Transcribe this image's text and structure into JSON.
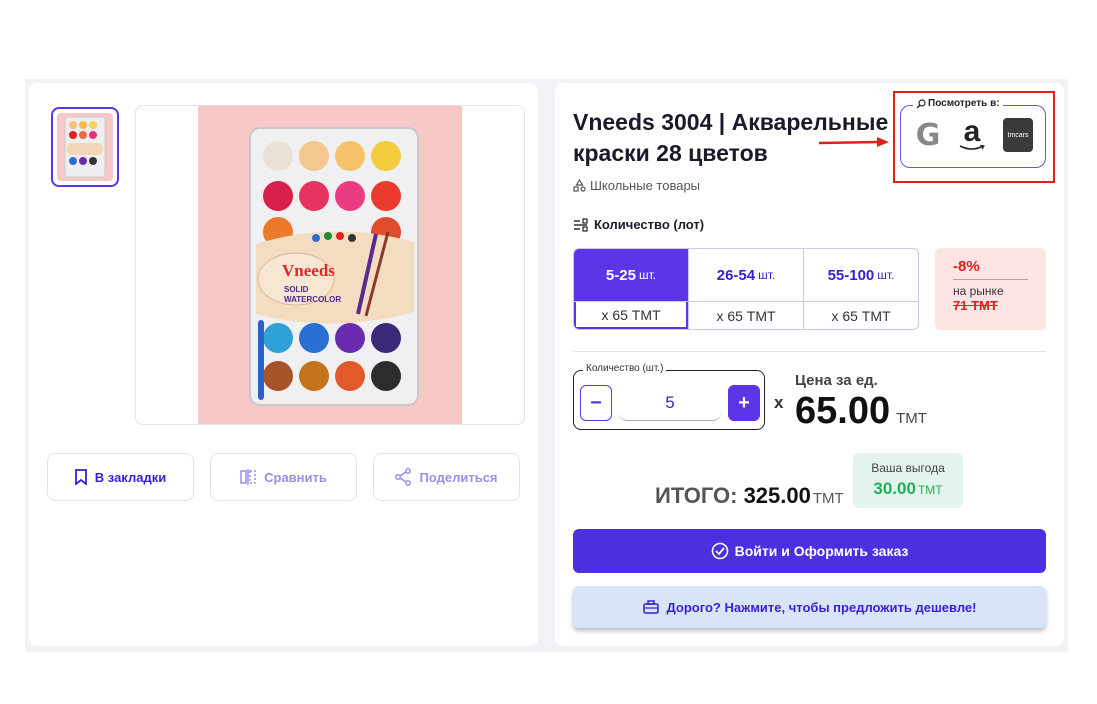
{
  "product": {
    "title": "Vneeds 3004 | Акварельные краски 28 цветов",
    "category": "Школьные товары",
    "image_brand": "Vneeds",
    "image_subtitle": "SOLID WATERCOLOR"
  },
  "actions": {
    "bookmark": "В закладки",
    "compare": "Сравнить",
    "share": "Поделиться"
  },
  "lookup": {
    "label": "Посмотреть в:",
    "google": "G",
    "amazon": "a",
    "tmcars": "tmcars"
  },
  "quantity": {
    "heading": "Количество (лот)",
    "tiers": [
      {
        "range": "5-25",
        "unit": "шт.",
        "price": "x 65 ТМТ",
        "active": true
      },
      {
        "range": "26-54",
        "unit": "шт.",
        "price": "x 65 ТМТ",
        "active": false
      },
      {
        "range": "55-100",
        "unit": "шт.",
        "price": "x 65 ТМТ",
        "active": false
      }
    ],
    "field_label": "Количество (шт.)",
    "value": "5",
    "minus": "−",
    "plus": "+"
  },
  "market": {
    "discount": "-8%",
    "label": "на рынке",
    "old_price": "71 ТМТ"
  },
  "pricing": {
    "times": "x",
    "unit_label": "Цена за ед.",
    "unit_price": "65.00",
    "currency": "ТМТ",
    "total_label": "ИТОГО:",
    "total_value": "325.00",
    "savings_label": "Ваша выгода",
    "savings_value": "30.00"
  },
  "buttons": {
    "order": "Войти и Оформить заказ",
    "offer": "Дорого? Нажмите, чтобы предложить дешевле!"
  },
  "colors": {
    "accent": "#5b35e6",
    "highlight": "#e0201d",
    "success": "#1fae5b"
  }
}
